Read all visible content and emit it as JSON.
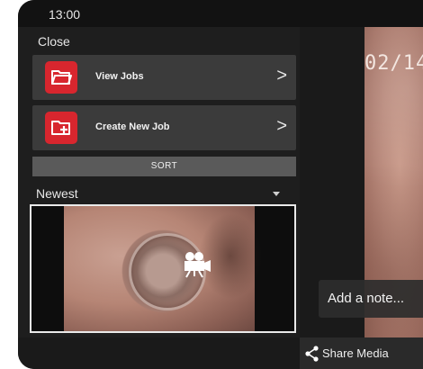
{
  "statusbar": {
    "time": "13:00"
  },
  "menu": {
    "close_label": "Close",
    "items": [
      {
        "label": "View Jobs",
        "icon": "folder-open-icon",
        "chevron": ">"
      },
      {
        "label": "Create New Job",
        "icon": "folder-add-icon",
        "chevron": ">"
      }
    ],
    "sort_label": "SORT",
    "sort_value": "Newest"
  },
  "thumbnail": {
    "icon": "video-camera-icon"
  },
  "preview": {
    "timestamp": "02/14"
  },
  "note": {
    "label": "Add a note..."
  },
  "share": {
    "label": "Share Media",
    "icon": "share-icon"
  },
  "colors": {
    "accent_red": "#d8262e",
    "panel": "#1e1e1e",
    "item_bg": "#3b3b3b",
    "sort_bg": "#5a5a5a"
  }
}
